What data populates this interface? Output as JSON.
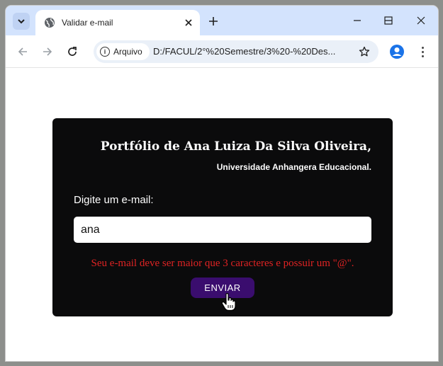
{
  "browser": {
    "tab_title": "Validar e-mail",
    "chip_label": "Arquivo",
    "url": "D:/FACUL/2°%20Semestre/3%20-%20Des..."
  },
  "page": {
    "title": "Portfólio de Ana Luiza Da Silva Oliveira,",
    "subtitle": "Universidade Anhangera Educacional.",
    "email_label": "Digite um e-mail:",
    "email_value": "ana",
    "error_message": "Seu e-mail deve ser maior que 3 caracteres e possuir um \"@\".",
    "submit_label": "ENVIAR"
  },
  "colors": {
    "card_bg": "#0b0b0c",
    "error": "#e02323",
    "button_bg": "#3a0d6e",
    "tabstrip": "#d3e3fd"
  }
}
